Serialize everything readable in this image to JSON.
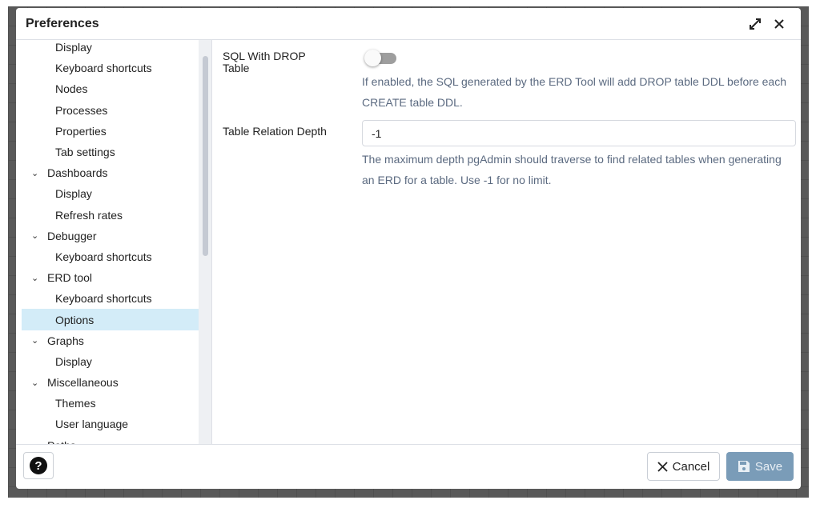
{
  "dialog": {
    "title": "Preferences"
  },
  "tree": [
    {
      "label": "Display",
      "level": "child"
    },
    {
      "label": "Keyboard shortcuts",
      "level": "child"
    },
    {
      "label": "Nodes",
      "level": "child"
    },
    {
      "label": "Processes",
      "level": "child"
    },
    {
      "label": "Properties",
      "level": "child"
    },
    {
      "label": "Tab settings",
      "level": "child"
    },
    {
      "label": "Dashboards",
      "level": "parent"
    },
    {
      "label": "Display",
      "level": "child"
    },
    {
      "label": "Refresh rates",
      "level": "child"
    },
    {
      "label": "Debugger",
      "level": "parent"
    },
    {
      "label": "Keyboard shortcuts",
      "level": "child"
    },
    {
      "label": "ERD tool",
      "level": "parent"
    },
    {
      "label": "Keyboard shortcuts",
      "level": "child"
    },
    {
      "label": "Options",
      "level": "child",
      "selected": true
    },
    {
      "label": "Graphs",
      "level": "parent"
    },
    {
      "label": "Display",
      "level": "child"
    },
    {
      "label": "Miscellaneous",
      "level": "parent"
    },
    {
      "label": "Themes",
      "level": "child"
    },
    {
      "label": "User language",
      "level": "child"
    },
    {
      "label": "Paths",
      "level": "parent-noexpand"
    }
  ],
  "settings": {
    "sql_drop": {
      "label": "SQL With DROP Table",
      "enabled": false,
      "help": "If enabled, the SQL generated by the ERD Tool will add DROP table DDL before each CREATE table DDL."
    },
    "depth": {
      "label": "Table Relation Depth",
      "value": "-1",
      "help": "The maximum depth pgAdmin should traverse to find related tables when generating an ERD for a table. Use -1 for no limit."
    }
  },
  "footer": {
    "help_icon": "?",
    "cancel": "Cancel",
    "save": "Save"
  },
  "colors": {
    "selected_bg": "#d3ecf8",
    "save_bg": "#7a9cb8"
  }
}
